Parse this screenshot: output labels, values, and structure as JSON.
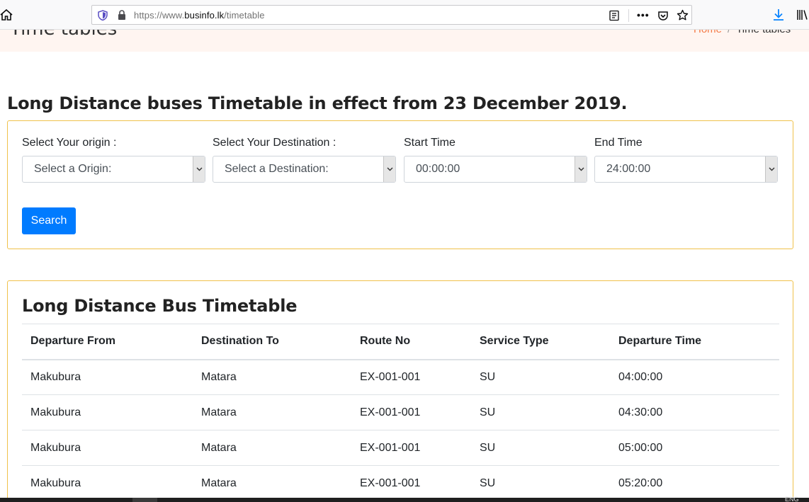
{
  "browser": {
    "url_prefix": "https://www.",
    "url_host": "businfo.lk",
    "url_path": "/timetable",
    "icons": [
      "home-icon",
      "shield-icon",
      "lock-icon",
      "reader-view-icon",
      "more-actions-icon",
      "pocket-icon",
      "bookmark-star-icon",
      "download-icon",
      "library-icon"
    ]
  },
  "page_header": {
    "title": "Time tables",
    "breadcrumb_home": "Home",
    "breadcrumb_separator": "/",
    "breadcrumb_current": "Time tables",
    "accent_color": "#f47b48"
  },
  "main_heading": "Long Distance buses Timetable in effect from 23 December 2019.",
  "search_form": {
    "origin_label": "Select Your origin :",
    "origin_value": "Select a Origin:",
    "destination_label": "Select Your Destination :",
    "destination_value": "Select a Destination:",
    "start_label": "Start Time",
    "start_value": "00:00:00",
    "end_label": "End Time",
    "end_value": "24:00:00",
    "search_label": "Search",
    "button_color": "#007bff",
    "card_border_color": "#f0c14b"
  },
  "timetable": {
    "title": "Long Distance Bus Timetable",
    "headers": [
      "Departure From",
      "Destination To",
      "Route No",
      "Service Type",
      "Departure Time"
    ],
    "rows": [
      [
        "Makubura",
        "Matara",
        "EX-001-001",
        "SU",
        "04:00:00"
      ],
      [
        "Makubura",
        "Matara",
        "EX-001-001",
        "SU",
        "04:30:00"
      ],
      [
        "Makubura",
        "Matara",
        "EX-001-001",
        "SU",
        "05:00:00"
      ],
      [
        "Makubura",
        "Matara",
        "EX-001-001",
        "SU",
        "05:20:00"
      ]
    ]
  },
  "taskbar": {
    "language": "ENG"
  }
}
